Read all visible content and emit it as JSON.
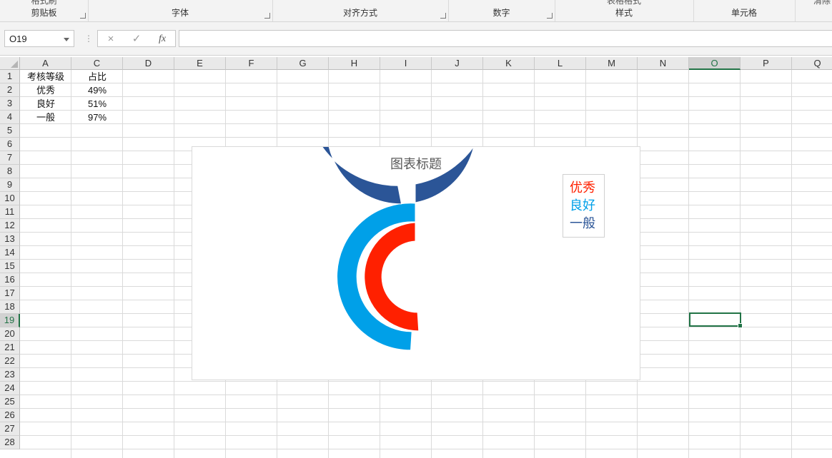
{
  "ribbon": {
    "groups": [
      {
        "label": "剪贴板",
        "top_partial": "格式刷"
      },
      {
        "label": "字体"
      },
      {
        "label": "对齐方式"
      },
      {
        "label": "数字"
      },
      {
        "label": "样式",
        "top_partial": "表格格式"
      },
      {
        "label": "单元格"
      },
      {
        "label": "",
        "top_partial": "清除"
      }
    ]
  },
  "formula_bar": {
    "name_box": "O19",
    "cancel_icon": "×",
    "enter_icon": "✓",
    "fx_label": "fx",
    "formula": ""
  },
  "columns": [
    "A",
    "C",
    "D",
    "E",
    "F",
    "G",
    "H",
    "I",
    "J",
    "K",
    "L",
    "M",
    "N",
    "O",
    "P",
    "Q"
  ],
  "selected_column": "O",
  "rows": [
    "1",
    "2",
    "3",
    "4",
    "5",
    "6",
    "7",
    "8",
    "9",
    "10",
    "11",
    "12",
    "13",
    "14",
    "15",
    "16",
    "17",
    "18",
    "19",
    "20",
    "21",
    "22",
    "23",
    "24",
    "25",
    "26",
    "27",
    "28"
  ],
  "selected_row": "19",
  "sheet_cells": {
    "A1": "考核等级",
    "C1": "占比",
    "A2": "优秀",
    "C2": "49%",
    "A3": "良好",
    "C3": "51%",
    "A4": "一般",
    "C4": "97%"
  },
  "chart_data": {
    "type": "doughnut",
    "title": "图表标题",
    "categories": [
      "优秀",
      "良好",
      "一般"
    ],
    "values": [
      0.49,
      0.51,
      0.97
    ],
    "ring_order_inner_to_outer": [
      "优秀",
      "良好",
      "一般"
    ],
    "colors": {
      "优秀": "#ff2000",
      "良好": "#00a0e8",
      "一般": "#2b5597"
    },
    "legend_position": "top-right",
    "legend": [
      "优秀",
      "良好",
      "一般"
    ]
  },
  "accent_color": "#217346"
}
